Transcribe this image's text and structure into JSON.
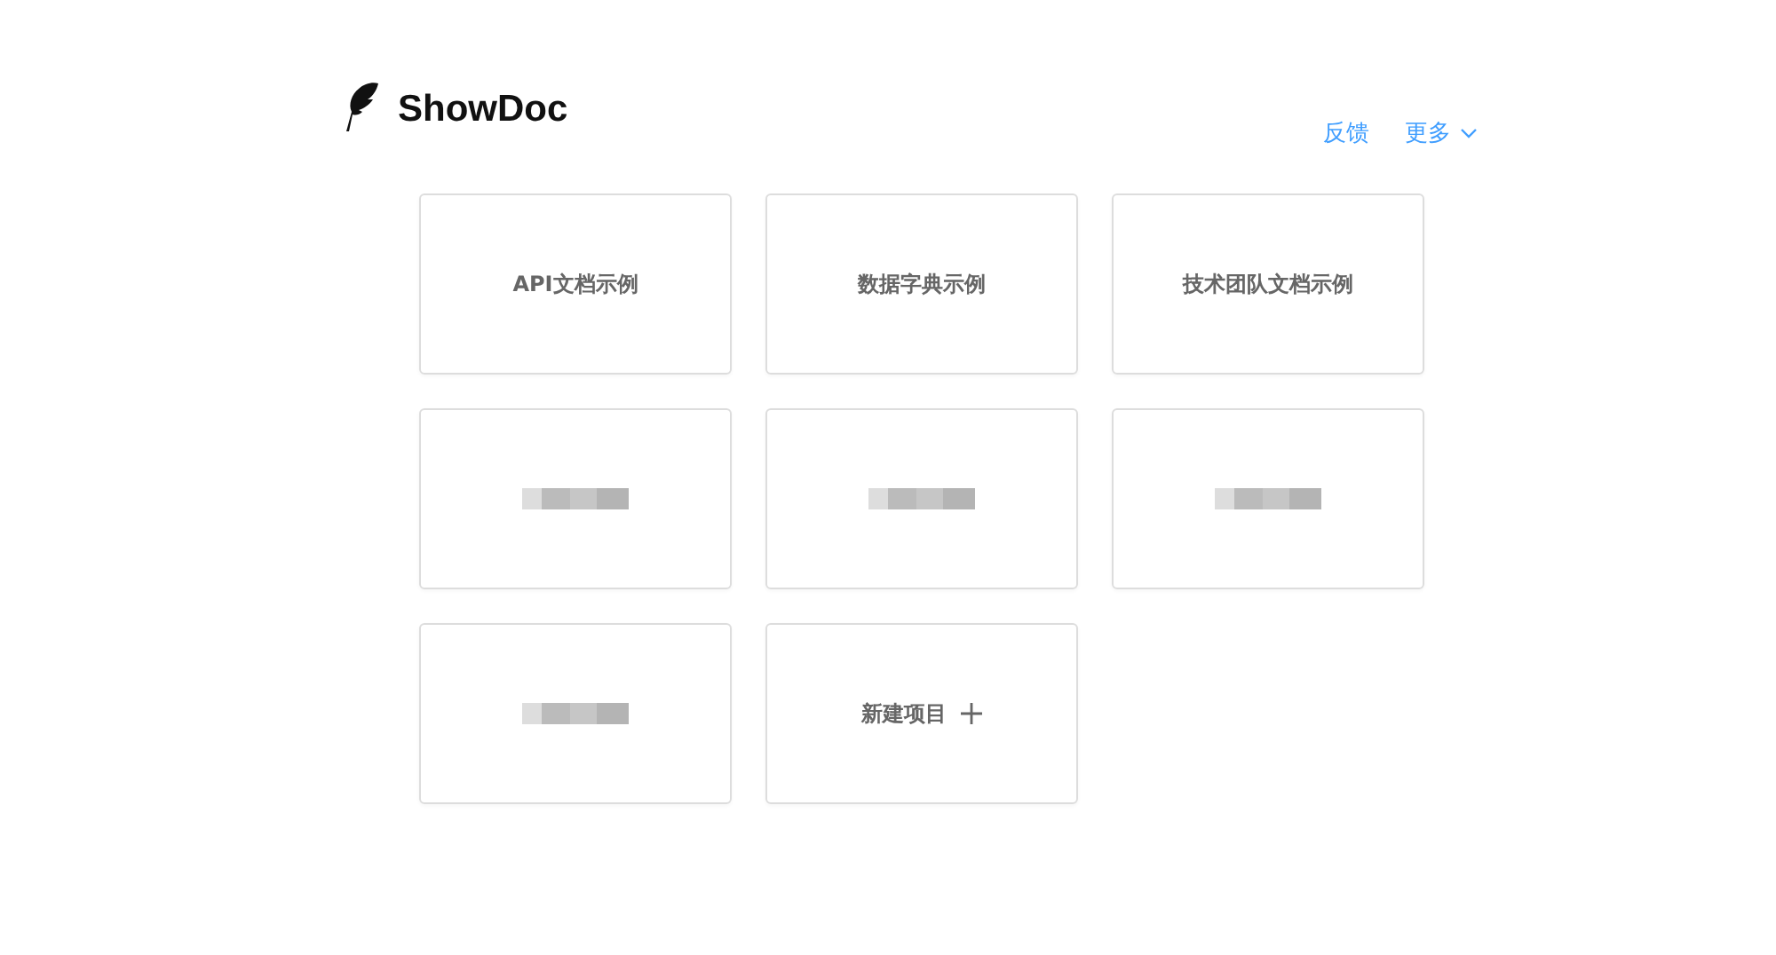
{
  "header": {
    "logo_text": "ShowDoc",
    "links": [
      {
        "label": "反馈",
        "kind": "link"
      },
      {
        "label": "更多",
        "kind": "dropdown"
      }
    ]
  },
  "projects": [
    {
      "kind": "project",
      "title": "API文档示例"
    },
    {
      "kind": "project",
      "title": "数据字典示例"
    },
    {
      "kind": "project",
      "title": "技术团队文档示例"
    },
    {
      "kind": "redacted"
    },
    {
      "kind": "redacted"
    },
    {
      "kind": "redacted"
    },
    {
      "kind": "redacted"
    },
    {
      "kind": "new",
      "title": "新建项目"
    }
  ]
}
